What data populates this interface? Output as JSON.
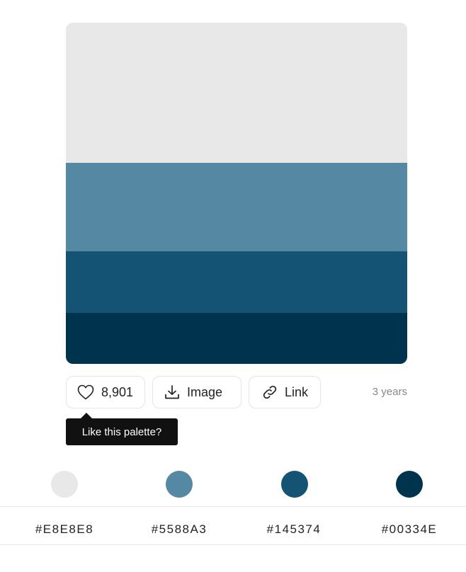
{
  "palette": {
    "colors": [
      {
        "hex": "#E8E8E8",
        "label": "#E8E8E8"
      },
      {
        "hex": "#5588A3",
        "label": "#5588A3"
      },
      {
        "hex": "#145374",
        "label": "#145374"
      },
      {
        "hex": "#00334E",
        "label": "#00334E"
      }
    ]
  },
  "actions": {
    "like_count": "8,901",
    "like_icon": "heart-icon",
    "image_label": "Image",
    "image_icon": "download-icon",
    "link_label": "Link",
    "link_icon": "link-icon",
    "age": "3 years"
  },
  "tooltip": {
    "text": "Like this palette?"
  }
}
